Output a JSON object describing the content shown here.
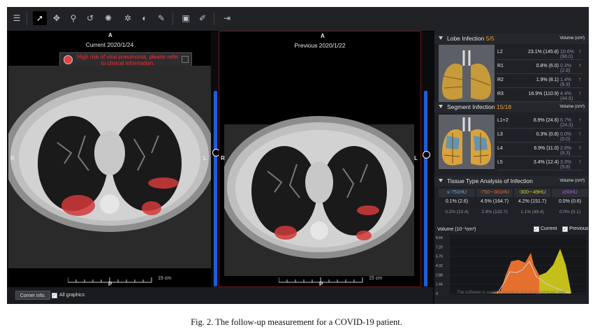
{
  "viewer": {
    "view_current": {
      "title": "Current 2020/1/24",
      "top_label": "A",
      "bottom_label": "P",
      "left_label": "R",
      "right_label": "L",
      "scale": "15 cm"
    },
    "view_previous": {
      "title": "Previous 2020/1/22",
      "top_label": "A",
      "bottom_label": "P",
      "left_label": "R",
      "right_label": "L",
      "scale": "15 cm"
    },
    "warning": "High risk of viral pneumonia, please refer to clinical information."
  },
  "toolbar": {
    "icons": [
      "menu-icon",
      "pointer-icon",
      "pan-icon",
      "zoom-icon",
      "rotate-icon",
      "window-level-icon",
      "settings-icon",
      "contrast-icon",
      "pen-icon",
      "overlay-icon",
      "eraser-icon",
      "export-icon"
    ]
  },
  "bottom": {
    "corner_info": "Corner info.",
    "all_graphics": "All graphics"
  },
  "lobe": {
    "title": "Lobe Infection",
    "count": "5/5",
    "unit": "Volume (cm³)",
    "rows": [
      {
        "name": "L2",
        "current": "23.1% (145.8)",
        "previous": "10.6% (96.0)"
      },
      {
        "name": "R1",
        "current": "0.8% (6.0)",
        "previous": "0.3% (2.8)"
      },
      {
        "name": "R2",
        "current": "1.9% (8.1)",
        "previous": "1.4% (6.9)"
      },
      {
        "name": "R3",
        "current": "16.9% (110.9)",
        "previous": "4.4% (44.6)"
      }
    ]
  },
  "segment": {
    "title": "Segment Infection",
    "count": "15/18",
    "unit": "Volume (cm³)",
    "rows": [
      {
        "name": "L1+2",
        "current": "8.9% (24.6)",
        "previous": "6.7% (24.3)"
      },
      {
        "name": "L3",
        "current": "0.3% (0.8)",
        "previous": "0.0% (0.0)"
      },
      {
        "name": "L4",
        "current": "6.9% (11.0)",
        "previous": "2.6% (8.3)"
      },
      {
        "name": "L5",
        "current": "3.4% (12.4)",
        "previous": "3.3% (9.8)"
      }
    ]
  },
  "tissue": {
    "title": "Tissue Type Analysis of Infection",
    "unit": "Volume (cm³)",
    "columns": [
      {
        "label": "≤-751HU",
        "current": "0.1% (2.6)",
        "previous": "0.2% (10.4)",
        "color": "#6fa8e8"
      },
      {
        "label": "-750~-301HU",
        "current": "4.5% (164.7)",
        "previous": "2.9% (132.7)",
        "color": "#e8662f"
      },
      {
        "label": "-300~-49HU",
        "current": "4.2% (151.7)",
        "previous": "1.1% (49.4)",
        "color": "#d8d21c"
      },
      {
        "label": "≥50HU",
        "current": "0.0% (0.6)",
        "previous": "0.0% (0.1)",
        "color": "#a65fe0"
      }
    ]
  },
  "histogram": {
    "title": "Volume (10⁻¹cm³)",
    "legend_current": "Current",
    "legend_previous": "Previous",
    "y_ticks": [
      "8.64",
      "7.20",
      "5.76",
      "4.32",
      "2.88",
      "1.44",
      "0"
    ]
  },
  "footer_note": "The software is used for research and study purposes only.",
  "caption": "Fig. 2.  The follow-up measurement for a COVID-19 patient.",
  "colors": {
    "accent": "#1e5fd8",
    "orange": "#f0a030",
    "warning_red": "#ff2b2b"
  }
}
